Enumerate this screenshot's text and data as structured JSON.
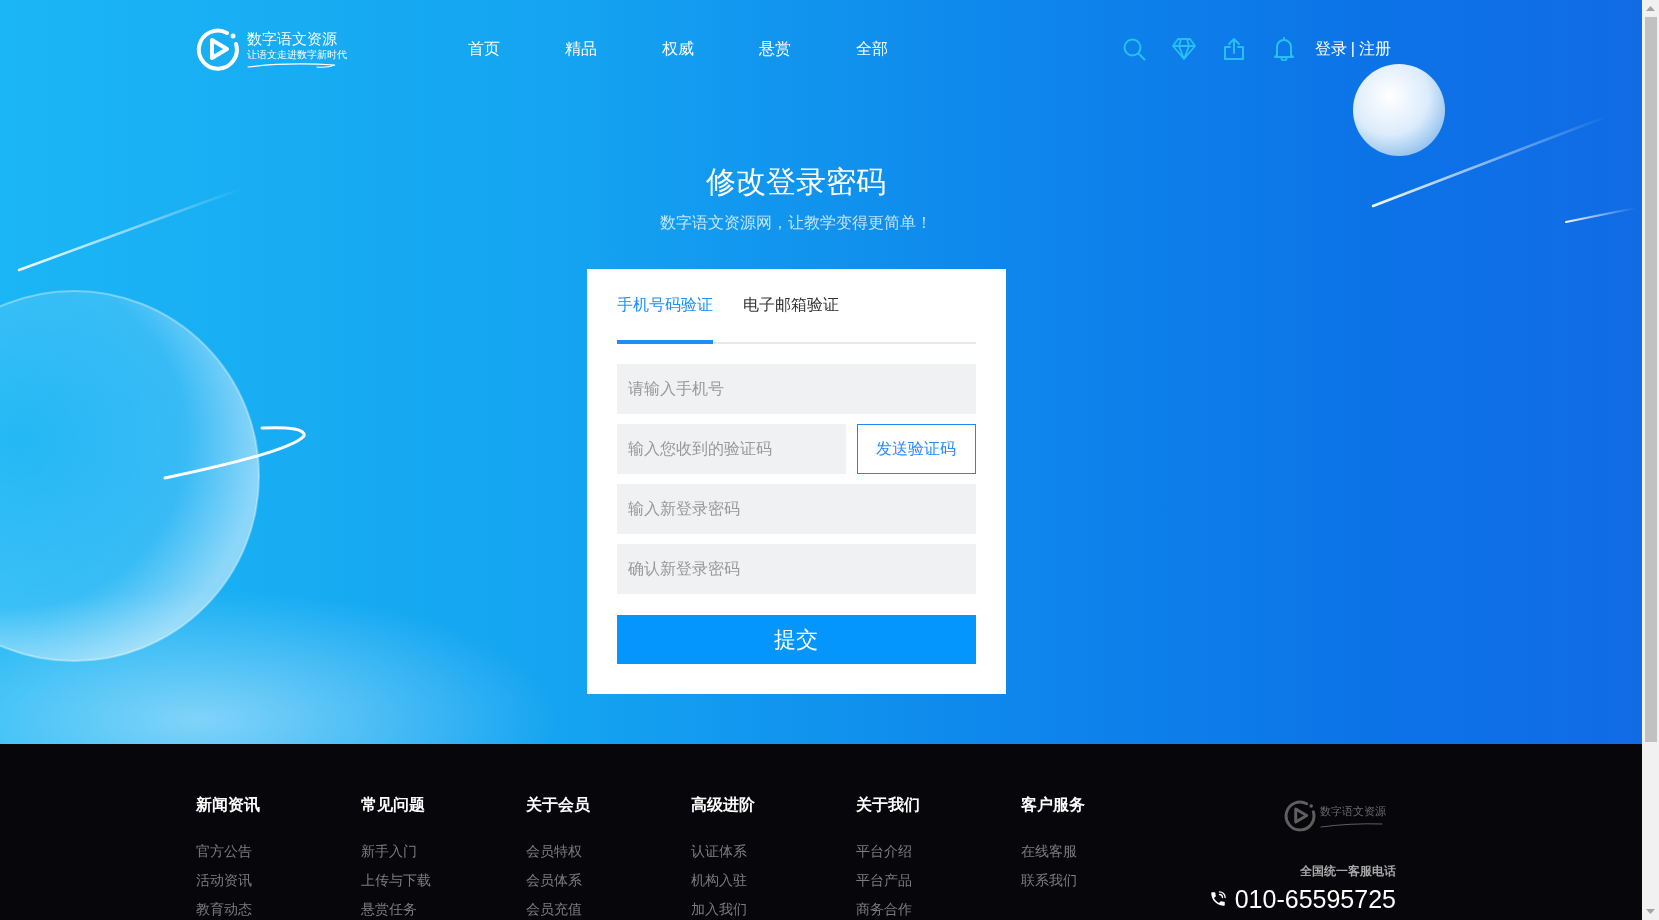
{
  "header": {
    "logo": {
      "name": "数字语文资源",
      "tagline": "让语文走进数字新时代"
    },
    "nav": [
      {
        "label": "首页"
      },
      {
        "label": "精品"
      },
      {
        "label": "权威"
      },
      {
        "label": "悬赏"
      },
      {
        "label": "全部"
      }
    ],
    "account": {
      "login": "登录",
      "separator": "|",
      "register": "注册"
    }
  },
  "hero": {
    "title": "修改登录密码",
    "subtitle": "数字语文资源网，让教学变得更简单！"
  },
  "form": {
    "tabs": [
      {
        "label": "手机号码验证",
        "selected": true
      },
      {
        "label": "电子邮箱验证",
        "selected": false
      }
    ],
    "fields": [
      {
        "kind": "text",
        "placeholder": "请输入手机号"
      },
      {
        "kind": "code",
        "placeholder": "输入您收到的验证码",
        "button": "发送验证码"
      },
      {
        "kind": "password",
        "placeholder": "输入新登录密码"
      },
      {
        "kind": "password",
        "placeholder": "确认新登录密码"
      }
    ],
    "submit": "提交"
  },
  "footer": {
    "columns": [
      {
        "title": "新闻资讯",
        "links": [
          "官方公告",
          "活动资讯",
          "教育动态"
        ]
      },
      {
        "title": "常见问题",
        "links": [
          "新手入门",
          "上传与下载",
          "悬赏任务"
        ]
      },
      {
        "title": "关于会员",
        "links": [
          "会员特权",
          "会员体系",
          "会员充值"
        ]
      },
      {
        "title": "高级进阶",
        "links": [
          "认证体系",
          "机构入驻",
          "加入我们"
        ]
      },
      {
        "title": "关于我们",
        "links": [
          "平台介绍",
          "平台产品",
          "商务合作"
        ]
      },
      {
        "title": "客户服务",
        "links": [
          "在线客服",
          "联系我们"
        ]
      }
    ],
    "logo": {
      "name": "数字语文资源"
    },
    "hotline": {
      "label": "全国统一客服电话",
      "number": "010-65595725"
    }
  }
}
